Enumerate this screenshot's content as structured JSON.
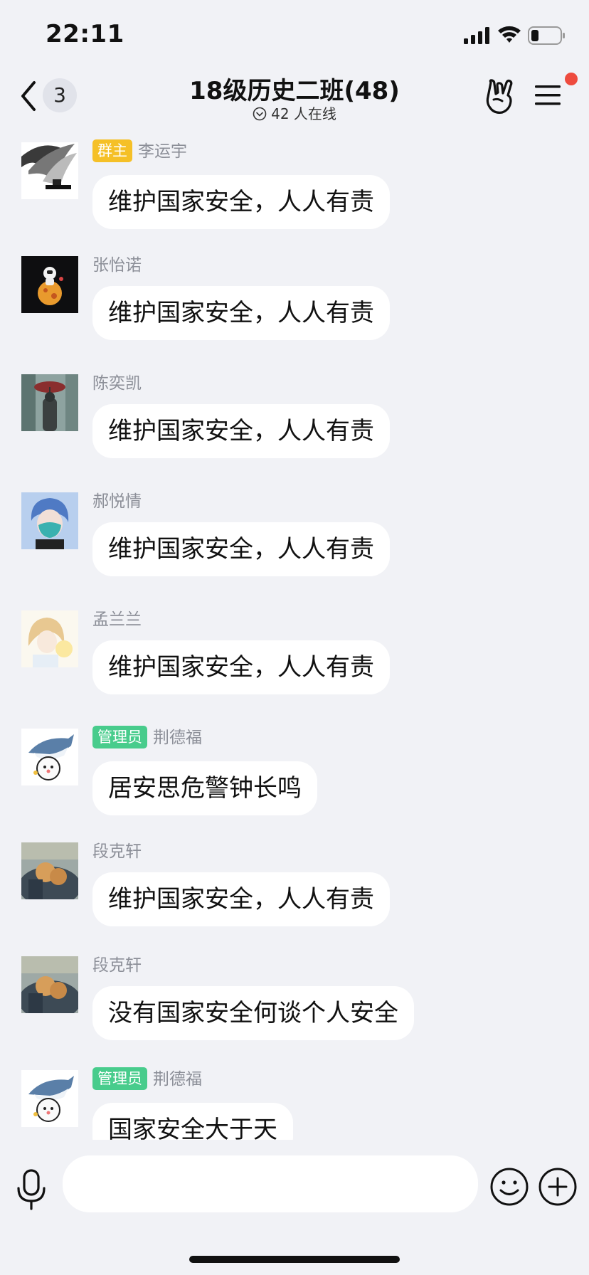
{
  "status_bar": {
    "time": "22:11",
    "icons": [
      "signal-icon",
      "wifi-icon",
      "battery-icon"
    ]
  },
  "header": {
    "back_icon": "chevron-left-icon",
    "unread_count": "3",
    "title": "18级历史二班(48)",
    "online_text": "42 人在线",
    "right_icons": [
      "rock-hand-icon",
      "menu-icon"
    ],
    "notification_dot_color": "#ee4b3e"
  },
  "colors": {
    "background": "#f1f2f6",
    "bubble": "#ffffff",
    "owner_tag": "#f5c027",
    "admin_tag": "#48cc8c",
    "name_gray": "#8c8f98"
  },
  "messages": [
    {
      "role": "群主",
      "role_type": "owner",
      "sender": "李运宇",
      "text": "维护国家安全，人人有责",
      "avatar": "feather-art"
    },
    {
      "role": "",
      "role_type": "",
      "sender": "张怡诺",
      "text": "维护国家安全，人人有责",
      "avatar": "astronaut-planet"
    },
    {
      "role": "",
      "role_type": "",
      "sender": "陈奕凯",
      "text": "维护国家安全，人人有责",
      "avatar": "umbrella-figure"
    },
    {
      "role": "",
      "role_type": "",
      "sender": "郝悦情",
      "text": "维护国家安全，人人有责",
      "avatar": "anime-mask"
    },
    {
      "role": "",
      "role_type": "",
      "sender": "孟兰兰",
      "text": "维护国家安全，人人有责",
      "avatar": "anime-girl-light"
    },
    {
      "role": "管理员",
      "role_type": "admin",
      "sender": "荆德福",
      "text": "居安思危警钟长鸣",
      "avatar": "shark-cartoon"
    },
    {
      "role": "",
      "role_type": "",
      "sender": "段克轩",
      "text": "维护国家安全，人人有责",
      "avatar": "photo-dogs"
    },
    {
      "role": "",
      "role_type": "",
      "sender": "段克轩",
      "text": "没有国家安全何谈个人安全",
      "avatar": "photo-dogs"
    },
    {
      "role": "管理员",
      "role_type": "admin",
      "sender": "荆德福",
      "text": "国家安全大于天",
      "avatar": "shark-cartoon"
    }
  ],
  "input_bar": {
    "placeholder": "",
    "icons": [
      "microphone-icon",
      "emoji-icon",
      "plus-icon"
    ]
  }
}
